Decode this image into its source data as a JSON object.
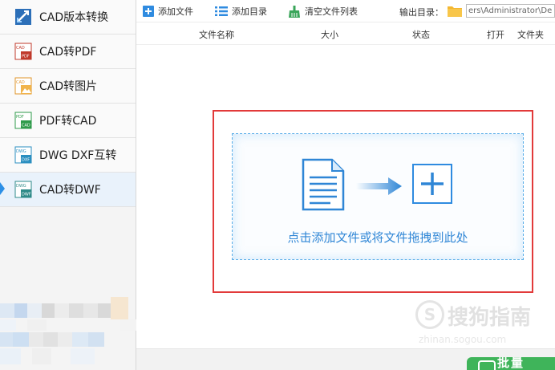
{
  "sidebar": {
    "items": [
      {
        "label": "CAD版本转换",
        "icon": "cad-version-icon",
        "active": false
      },
      {
        "label": "CAD转PDF",
        "icon": "cad-to-pdf-icon",
        "active": false
      },
      {
        "label": "CAD转图片",
        "icon": "cad-to-image-icon",
        "active": false
      },
      {
        "label": "PDF转CAD",
        "icon": "pdf-to-cad-icon",
        "active": false
      },
      {
        "label": "DWG DXF互转",
        "icon": "dwg-dxf-icon",
        "active": false
      },
      {
        "label": "CAD转DWF",
        "icon": "cad-to-dwf-icon",
        "active": true
      }
    ]
  },
  "toolbar": {
    "add_file": "添加文件",
    "add_dir": "添加目录",
    "clear_list": "清空文件列表",
    "output_label": "输出目录：",
    "output_path": "ers\\Administrator\\De"
  },
  "table": {
    "headers": [
      "文件名称",
      "大小",
      "状态",
      "打开",
      "文件夹"
    ]
  },
  "drop_zone": {
    "hint": "点击添加文件或将文件拖拽到此处"
  },
  "icons": {
    "pdf_small": "PDF",
    "cad_small": "CAD",
    "dwg_small": "DWG",
    "dxf_small": "DXF",
    "dwf_small": "DWF"
  },
  "convert_button": {
    "label": "批量"
  },
  "watermark": {
    "logo": "S",
    "text": "搜狗指南",
    "sub": "zhinan.sogou.com"
  },
  "colors": {
    "accent": "#2f86d6",
    "highlight_frame": "#e23a3a",
    "convert": "#3fb45a"
  }
}
